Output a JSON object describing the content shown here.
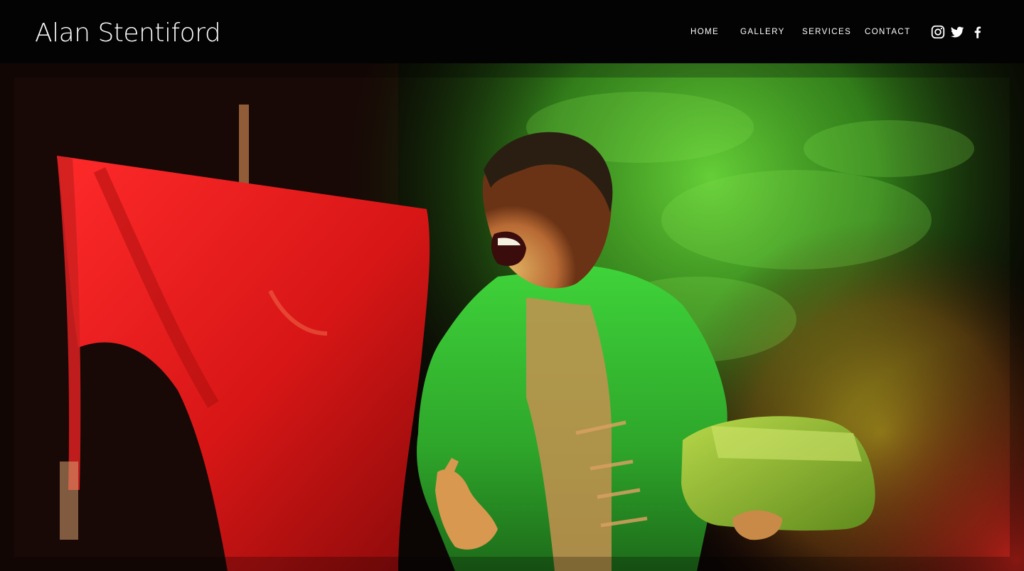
{
  "site": {
    "title": "Alan Stentiford"
  },
  "nav": {
    "items": [
      {
        "label": "HOME"
      },
      {
        "label": "GALLERY"
      },
      {
        "label": "SERVICES"
      },
      {
        "label": "CONTACT"
      }
    ]
  },
  "social": {
    "icons": [
      "instagram-icon",
      "twitter-icon",
      "facebook-icon"
    ]
  },
  "hero": {
    "image": "stage-performer-photo",
    "colors": {
      "background": "#000000",
      "smoke_green": "#4cc62a",
      "flag_red": "#e01a1a",
      "costume_green": "#2fa82a"
    }
  }
}
